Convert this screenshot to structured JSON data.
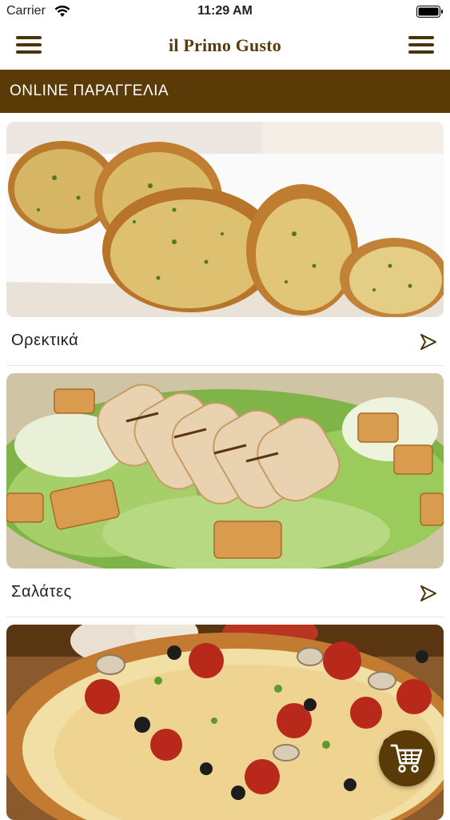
{
  "status_bar": {
    "carrier": "Carrier",
    "time": "11:29 AM"
  },
  "header": {
    "brand": "il Primo Gusto"
  },
  "section": {
    "title": "ONLINE ΠΑΡΑΓΓΕΛΙΑ"
  },
  "categories": [
    {
      "label": "Ορεκτικά",
      "image_icon": "garlic-bread-photo"
    },
    {
      "label": "Σαλάτες",
      "image_icon": "caesar-salad-photo"
    },
    {
      "label": "",
      "image_icon": "pizza-photo"
    }
  ],
  "cart": {
    "icon": "cart-icon"
  },
  "colors": {
    "brand": "#5a3b07",
    "header_text": "#5a3b0a"
  }
}
